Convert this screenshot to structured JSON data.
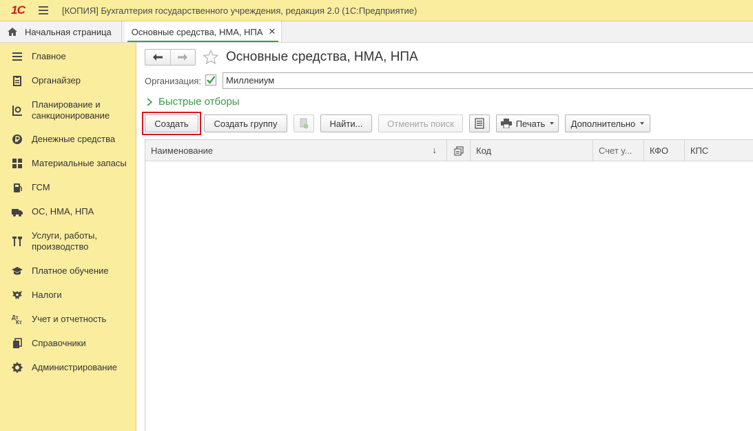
{
  "window": {
    "logo_text": "1С",
    "title": "[КОПИЯ] Бухгалтерия государственного учреждения, редакция 2.0  (1С:Предприятие)"
  },
  "tabs": {
    "home_label": "Начальная страница",
    "active_label": "Основные средства, НМА, НПА",
    "close_glyph": "✕"
  },
  "sidebar": {
    "items": [
      {
        "label": "Главное",
        "icon": "list-icon"
      },
      {
        "label": "Органайзер",
        "icon": "clipboard-icon"
      },
      {
        "label": "Планирование и санкционирование",
        "icon": "planning-icon"
      },
      {
        "label": "Денежные средства",
        "icon": "ruble-icon"
      },
      {
        "label": "Материальные запасы",
        "icon": "grid-icon"
      },
      {
        "label": "ГСМ",
        "icon": "fuel-icon"
      },
      {
        "label": "ОС, НМА, НПА",
        "icon": "truck-icon"
      },
      {
        "label": "Услуги, работы, производство",
        "icon": "tools-icon"
      },
      {
        "label": "Платное обучение",
        "icon": "graduation-cap-icon"
      },
      {
        "label": "Налоги",
        "icon": "eagle-emblem-icon"
      },
      {
        "label": "Учет и отчетность",
        "icon": "debit-credit-icon"
      },
      {
        "label": "Справочники",
        "icon": "books-icon"
      },
      {
        "label": "Администрирование",
        "icon": "gear-icon"
      }
    ]
  },
  "form": {
    "title": "Основные средства, НМА, НПА",
    "org_label": "Организация:",
    "org_value": "Миллениум",
    "quick_filters": "Быстрые отборы"
  },
  "toolbar": {
    "create": "Создать",
    "create_group": "Создать группу",
    "find": "Найти...",
    "cancel_search": "Отменить поиск",
    "print": "Печать",
    "more": "Дополнительно"
  },
  "table": {
    "columns": [
      "Наименование",
      "Код",
      "Счет у...",
      "КФО",
      "КПС"
    ],
    "sort_glyph": "↓"
  },
  "colors": {
    "accent_green": "#3a9a45",
    "sidebar_bg": "#fbed9e",
    "highlight_red": "#e0141c"
  }
}
